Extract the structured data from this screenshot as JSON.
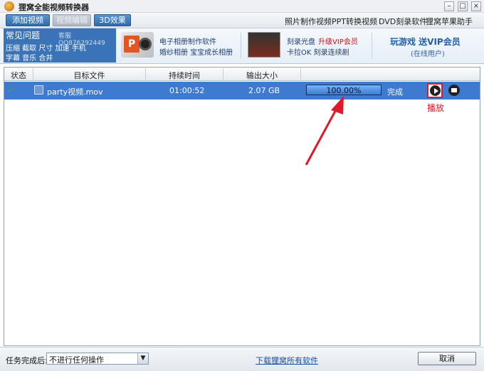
{
  "window": {
    "title": "狸窝全能视频转换器"
  },
  "toolbar": {
    "add_video": "添加视频",
    "edit_video": "视频编辑",
    "effect_3d": "3D效果",
    "links": [
      "照片制作视频",
      "PPT转换视频",
      "DVD刻录软件",
      "狸窝苹果助手"
    ]
  },
  "promo": {
    "faq_title": "常见问题",
    "faq_qq": "客服QQ876292449",
    "faq_line1": "压缩 截取 尺寸 加速 手机",
    "faq_line2": "字幕 音乐 合并",
    "item1_line1": "电子相册制作软件",
    "item1_line2": "婚纱相册 宝宝成长相册",
    "item2_line1a": "刻录光盘",
    "item2_line1b": "升级VIP会员",
    "item2_line2": "卡拉OK 刻录连续剧",
    "game_title": "玩游戏 送VIP会员",
    "game_sub": "(在线用户)"
  },
  "table": {
    "headers": [
      "状态",
      "目标文件",
      "持续时间",
      "输出大小"
    ],
    "rows": [
      {
        "filename": "party视频.mov",
        "duration": "01:00:52",
        "size": "2.07 GB",
        "progress": "100.00%",
        "status": "完成"
      }
    ],
    "progress_fraction": 1.0
  },
  "annotation": {
    "play_label": "播放"
  },
  "bottom": {
    "label": "任务完成后:",
    "select_value": "不进行任何操作",
    "download_link": "下载狸窝所有软件",
    "cancel": "取消"
  },
  "colors": {
    "row_selected": "#3d7ad0",
    "accent_red": "#e0192a"
  }
}
